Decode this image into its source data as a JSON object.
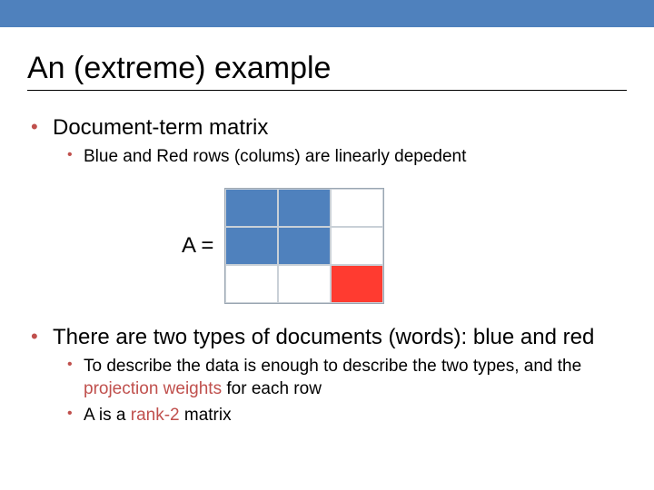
{
  "title": "An (extreme) example",
  "bullets": {
    "b1": "Document-term matrix",
    "b1a": "Blue and Red rows (colums) are linearly depedent",
    "b2": "There are two types of documents (words): blue and red",
    "b2a_pre": "To describe the data is enough to describe the two types, and the ",
    "b2a_hl": "projection weights",
    "b2a_post": " for each row",
    "b2b_pre": "A is a ",
    "b2b_hl": "rank-2",
    "b2b_post": " matrix"
  },
  "matrix": {
    "label": "A =",
    "cells": [
      "blue",
      "blue",
      "white",
      "blue",
      "blue",
      "white",
      "white",
      "white",
      "red"
    ]
  },
  "colors": {
    "accent_blue": "#4f81bd",
    "accent_red": "#c0504d",
    "matrix_red": "#ff3b30"
  }
}
